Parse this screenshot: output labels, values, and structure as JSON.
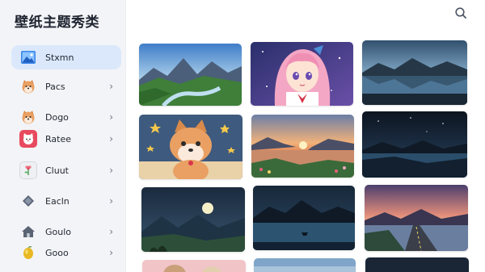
{
  "app": {
    "title": "壁纸主题秀类"
  },
  "sidebar": {
    "items": [
      {
        "label": "Stxmn",
        "icon": "landscape-photo-icon",
        "active": true
      },
      {
        "label": "Pacs",
        "icon": "shiba-dog-icon",
        "active": false
      },
      {
        "label": "Dogo",
        "icon": "shiba-dog-icon",
        "active": false
      },
      {
        "label": "Ratee",
        "icon": "cat-face-icon",
        "active": false
      },
      {
        "label": "Cluut",
        "icon": "flower-icon",
        "active": false
      },
      {
        "label": "Eacln",
        "icon": "gem-icon",
        "active": false
      },
      {
        "label": "Goulo",
        "icon": "house-icon",
        "active": false
      },
      {
        "label": "Gooo",
        "icon": "lemon-icon",
        "active": false
      }
    ]
  },
  "header": {
    "search_icon": "search-icon"
  },
  "wallpapers": [
    {
      "name": "mountain-river-valley"
    },
    {
      "name": "anime-girl-pink-hair"
    },
    {
      "name": "lake-reflection-dusk"
    },
    {
      "name": "shiba-dog-stars"
    },
    {
      "name": "sunset-lake-flowers"
    },
    {
      "name": "night-lake-mountains"
    },
    {
      "name": "moonlit-valley"
    },
    {
      "name": "night-lake-boat"
    },
    {
      "name": "sunset-road-lake"
    },
    {
      "name": "partial-cat-pink"
    },
    {
      "name": "partial-blue-sky"
    },
    {
      "name": "partial-night"
    }
  ]
}
